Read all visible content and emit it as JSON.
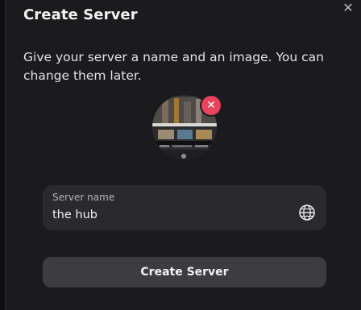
{
  "dialog": {
    "title": "Create Server",
    "close_icon": "close-icon",
    "description": "Give your server a name and an image. You can change them later."
  },
  "avatar": {
    "remove_icon": "close-icon"
  },
  "server_name_field": {
    "label": "Server name",
    "value": "the hub",
    "icon": "globe-icon"
  },
  "actions": {
    "create_label": "Create Server"
  },
  "colors": {
    "background": "#1b1b1e",
    "field": "#2a2a2e",
    "button": "#3c3c41",
    "remove_badge": "#e8435c",
    "text": "#f2f2f3"
  }
}
